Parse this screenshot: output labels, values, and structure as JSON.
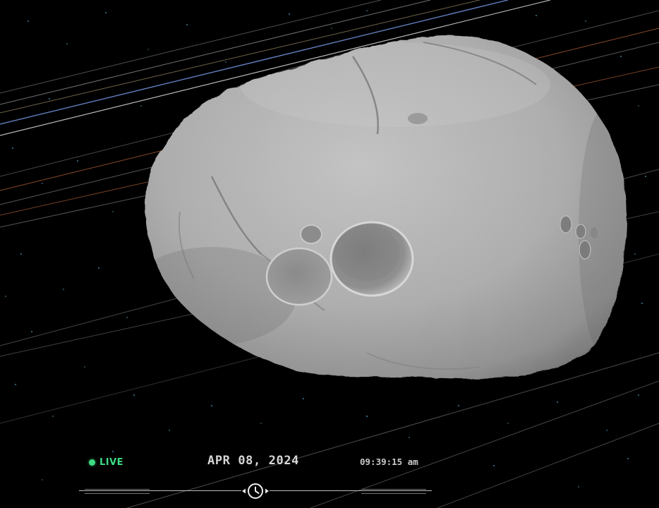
{
  "status": {
    "live_label": "LIVE",
    "live_color": "#3ddc84"
  },
  "time_controls": {
    "date": "APR 08, 2024",
    "time": "09:39:15 am",
    "scrubber_icon": "clock-icon"
  },
  "scene": {
    "object": "asteroid",
    "background_color": "#000000"
  }
}
